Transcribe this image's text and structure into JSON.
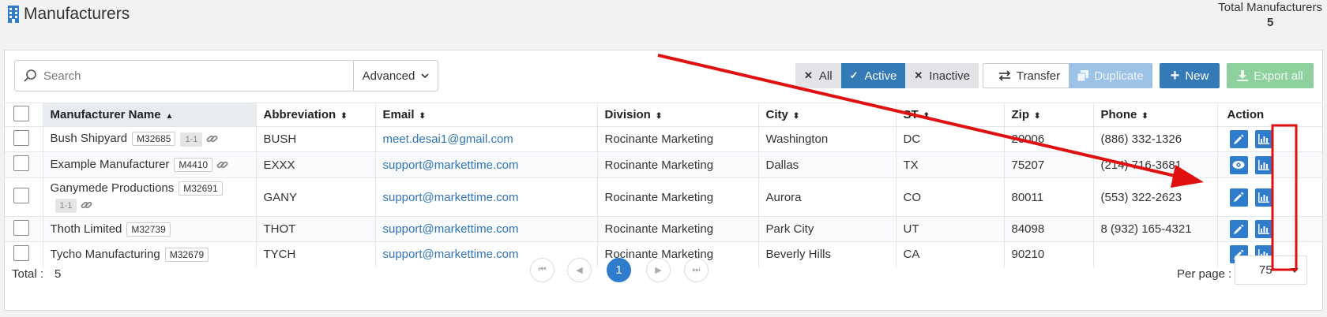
{
  "header": {
    "title": "Manufacturers",
    "title_icon": "building-icon",
    "total_label": "Total Manufacturers",
    "total_value": "5"
  },
  "toolbar": {
    "search_placeholder": "Search",
    "search_value": "",
    "advanced_label": "Advanced",
    "filters": [
      {
        "label": "All",
        "icon": "x-icon",
        "active": false
      },
      {
        "label": "Active",
        "icon": "check-icon",
        "active": true
      },
      {
        "label": "Inactive",
        "icon": "x-icon",
        "active": false
      }
    ],
    "transfer_label": "Transfer",
    "duplicate_label": "Duplicate",
    "new_label": "New",
    "export_label": "Export all"
  },
  "table": {
    "columns": [
      "Manufacturer Name",
      "Abbreviation",
      "Email",
      "Division",
      "City",
      "ST",
      "Zip",
      "Phone",
      "Action"
    ],
    "sorted_column": "Manufacturer Name",
    "rows": [
      {
        "name": "Bush Shipyard",
        "code": "M32685",
        "tag2": "1-1",
        "link": true,
        "abbr": "BUSH",
        "email": "meet.desai1@gmail.com",
        "division": "Rocinante Marketing",
        "city": "Washington",
        "st": "DC",
        "zip": "20006",
        "phone": "(886) 332-1326",
        "actions": [
          "pencil-icon",
          "chart-icon"
        ]
      },
      {
        "name": "Example Manufacturer",
        "code": "M4410",
        "tag2": "",
        "link": true,
        "abbr": "EXXX",
        "email": "support@markettime.com",
        "division": "Rocinante Marketing",
        "city": "Dallas",
        "st": "TX",
        "zip": "75207",
        "phone": "(214) 716-3681",
        "actions": [
          "eye-icon",
          "chart-icon"
        ]
      },
      {
        "name": "Ganymede Productions",
        "code": "M32691",
        "tag2": "1-1",
        "link": true,
        "abbr": "GANY",
        "email": "support@markettime.com",
        "division": "Rocinante Marketing",
        "city": "Aurora",
        "st": "CO",
        "zip": "80011",
        "phone": "(553) 322-2623",
        "actions": [
          "pencil-icon",
          "chart-icon"
        ]
      },
      {
        "name": "Thoth Limited",
        "code": "M32739",
        "tag2": "",
        "link": false,
        "abbr": "THOT",
        "email": "support@markettime.com",
        "division": "Rocinante Marketing",
        "city": "Park City",
        "st": "UT",
        "zip": "84098",
        "phone": "8 (932) 165-4321",
        "actions": [
          "pencil-icon",
          "chart-icon"
        ]
      },
      {
        "name": "Tycho Manufacturing",
        "code": "M32679",
        "tag2": "",
        "link": false,
        "abbr": "TYCH",
        "email": "support@markettime.com",
        "division": "Rocinante Marketing",
        "city": "Beverly Hills",
        "st": "CA",
        "zip": "90210",
        "phone": "",
        "actions": [
          "pencil-icon",
          "chart-icon"
        ]
      }
    ]
  },
  "footer": {
    "total_label": "Total :",
    "total_value": "5",
    "current_page": "1",
    "per_page_label": "Per page :",
    "per_page_value": "75"
  },
  "colors": {
    "primary": "#337ab7",
    "annotation": "#e01010"
  }
}
